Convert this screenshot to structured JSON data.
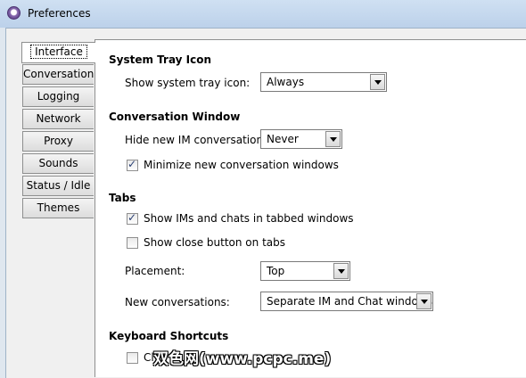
{
  "window": {
    "title": "Preferences"
  },
  "tabs": [
    {
      "label": "Interface",
      "active": true
    },
    {
      "label": "Conversations"
    },
    {
      "label": "Logging"
    },
    {
      "label": "Network"
    },
    {
      "label": "Proxy"
    },
    {
      "label": "Sounds"
    },
    {
      "label": "Status / Idle"
    },
    {
      "label": "Themes"
    }
  ],
  "system_tray": {
    "heading": "System Tray Icon",
    "label": "Show system tray icon:",
    "value": "Always"
  },
  "conversation_window": {
    "heading": "Conversation Window",
    "hide_label": "Hide new IM conversations:",
    "hide_value": "Never",
    "minimize_label": "Minimize new conversation windows",
    "minimize_checked": true
  },
  "tabs_section": {
    "heading": "Tabs",
    "tabbed_label": "Show IMs and chats in tabbed windows",
    "tabbed_checked": true,
    "close_label": "Show close button on tabs",
    "close_checked": false,
    "placement_label": "Placement:",
    "placement_value": "Top",
    "new_conv_label": "New conversations:",
    "new_conv_value": "Separate IM and Chat windows"
  },
  "keyboard": {
    "heading": "Keyboard Shortcuts",
    "first_label_fragment": "Cl"
  },
  "watermark": "双色网(www.pcpc.me)"
}
